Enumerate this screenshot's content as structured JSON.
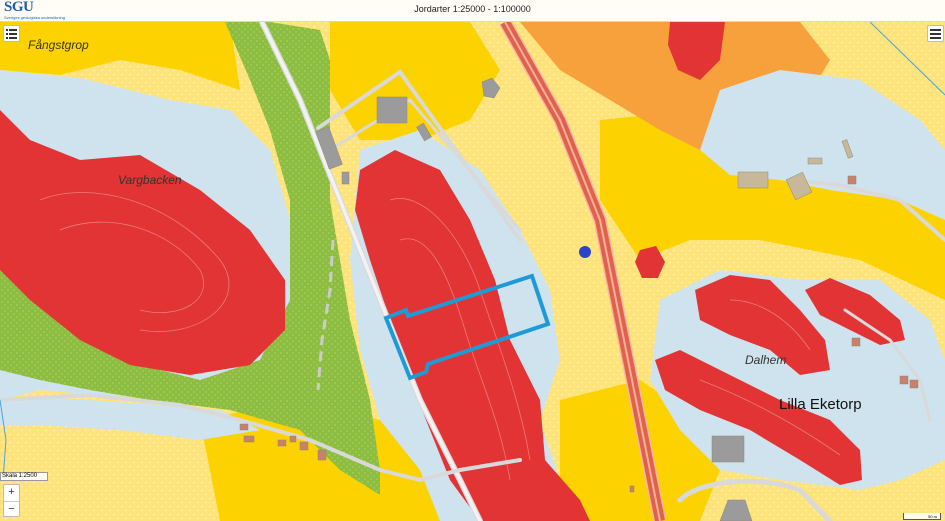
{
  "header": {
    "title": "Jordarter 1:25000 - 1:100000",
    "logo_text": "SGU",
    "logo_subtitle": "Sveriges geologiska undersökning"
  },
  "places": {
    "fangstgrop": "Fångstgrop",
    "vargbacken": "Vargbacken",
    "dalhem": "Dalhem",
    "lilla_eketorp": "Lilla Eketorp"
  },
  "controls": {
    "scale_text": "Skala 1:2500",
    "zoom_in": "+",
    "zoom_out": "−",
    "scalebar_text": "50 m",
    "left_menu_icon": "list-icon",
    "right_menu_icon": "hamburger-icon"
  },
  "colors": {
    "rock": "#e23434",
    "clay": "#cfe3ef",
    "sand_yellow": "#fddc66",
    "gravel": "#fcd200",
    "peat_orange": "#f7a13c",
    "green": "#8cbd3f",
    "selection": "#1e9bd7",
    "marker": "#2a44c9",
    "road": "#d9d9d9",
    "highway": "#e0624a"
  }
}
